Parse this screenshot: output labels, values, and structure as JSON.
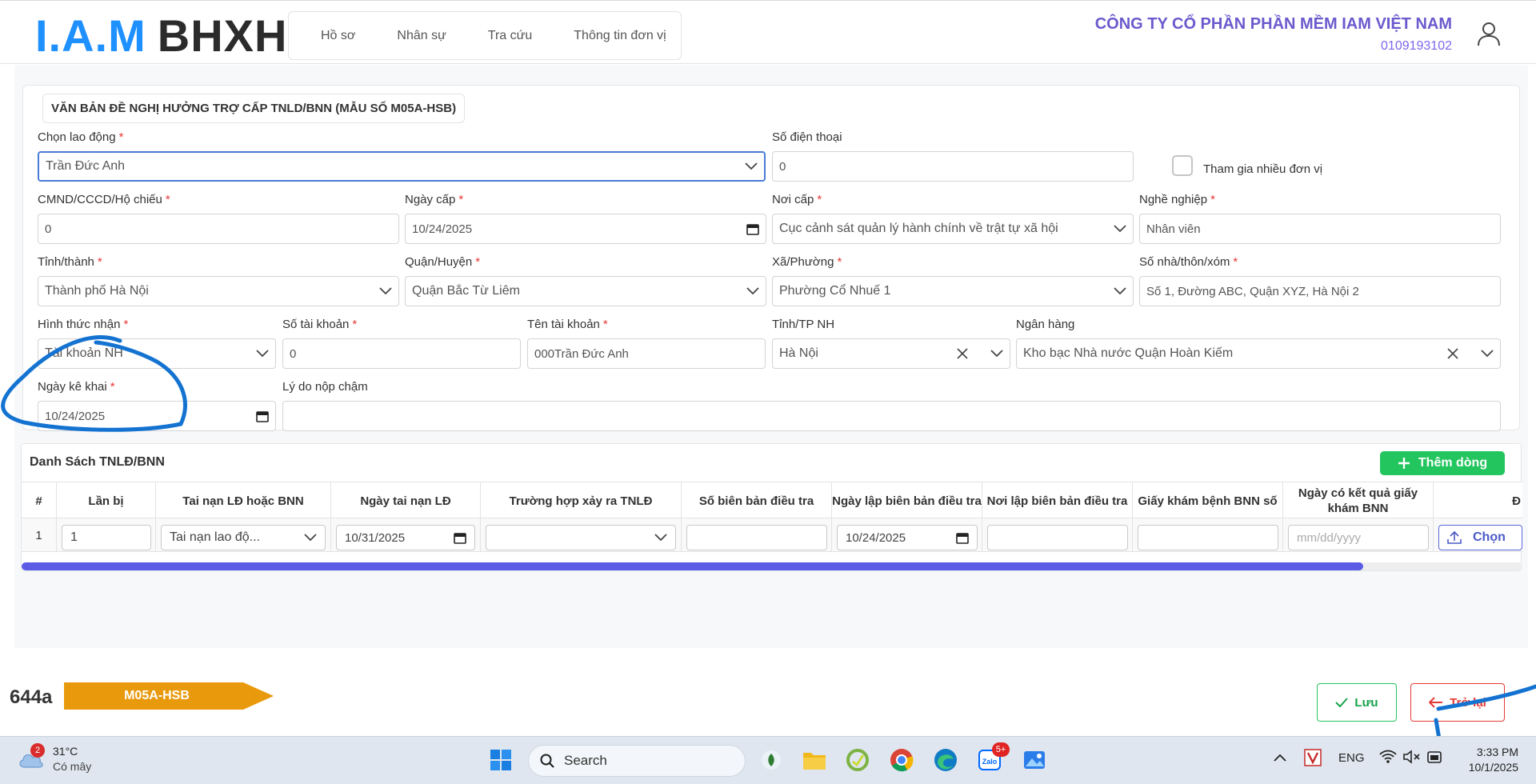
{
  "header": {
    "logo_left": "I.A.M",
    "logo_right": "BHXH",
    "nav": [
      "Hồ sơ",
      "Nhân sự",
      "Tra cứu",
      "Thông tin đơn vị"
    ],
    "company_name": "CÔNG TY CỔ PHẦN PHẦN MỀM IAM VIỆT NAM",
    "tax_code": "0109193102"
  },
  "form": {
    "title": "VĂN BẢN ĐỀ NGHỊ HƯỞNG TRỢ CẤP TNLD/BNN (MẪU SỐ M05A-HSB)",
    "required_mark": "*",
    "employee": {
      "label": "Chọn lao động",
      "value": "Trần Đức Anh"
    },
    "phone": {
      "label": "Số điện thoại",
      "value": "0"
    },
    "multi_unit": {
      "label": "Tham gia nhiều đơn vị",
      "checked": false
    },
    "id_number": {
      "label": "CMND/CCCD/Hộ chiếu",
      "value": "0"
    },
    "issue_date": {
      "label": "Ngày cấp",
      "value": "10/24/2025"
    },
    "issue_place": {
      "label": "Nơi cấp",
      "value": "Cục cảnh sát quản lý hành chính về trật tự xã hội"
    },
    "occupation": {
      "label": "Nghề nghiệp",
      "value": "Nhân viên"
    },
    "province": {
      "label": "Tỉnh/thành",
      "value": "Thành phố Hà Nội"
    },
    "district": {
      "label": "Quận/Huyện",
      "value": "Quận Bắc Từ Liêm"
    },
    "ward": {
      "label": "Xã/Phường",
      "value": "Phường Cổ Nhuế 1"
    },
    "address": {
      "label": "Số nhà/thôn/xóm",
      "value": "Số 1, Đường ABC, Quận XYZ, Hà Nội 2"
    },
    "receive_method": {
      "label": "Hình thức nhận",
      "value": "Tài khoản NH"
    },
    "account_no": {
      "label": "Số tài khoản",
      "value": "0"
    },
    "account_name": {
      "label": "Tên tài khoản",
      "value": "000Trần Đức Anh"
    },
    "bank_province": {
      "label": "Tỉnh/TP NH",
      "value": "Hà Nội"
    },
    "bank": {
      "label": "Ngân hàng",
      "value": "Kho bạc Nhà nước Quận Hoàn Kiếm"
    },
    "declare_date": {
      "label": "Ngày kê khai",
      "value": "10/24/2025"
    },
    "late_reason": {
      "label": "Lý do nộp chậm",
      "value": ""
    }
  },
  "table": {
    "title": "Danh Sách TNLĐ/BNN",
    "add_button": "Thêm dòng",
    "columns": [
      "#",
      "Lần bị",
      "Tai nạn LĐ hoặc BNN",
      "Ngày tai nạn LĐ",
      "Trường hợp xảy ra TNLĐ",
      "Số biên bản điều tra",
      "Ngày lập biên bản điều tra",
      "Nơi lập biên bản điều tra",
      "Giấy khám bệnh BNN số",
      "Ngày có kết quả giấy khám BNN",
      "Đ"
    ],
    "rows": [
      {
        "index": "1",
        "times": "1",
        "type": "Tai nạn lao độ...",
        "accident_date": "10/31/2025",
        "case": "",
        "report_no": "",
        "report_date": "10/24/2025",
        "report_place": "",
        "bnn_paper": "",
        "result_date_placeholder": "mm/dd/yyyy",
        "upload_label": "Chọn"
      }
    ],
    "scroll_fraction": 0.894
  },
  "footer": {
    "doc_code": "644a",
    "form_tag": "M05A-HSB",
    "save": "Lưu",
    "back": "Trở lại"
  },
  "taskbar": {
    "weather_temp": "31°C",
    "weather_desc": "Có mây",
    "weather_badge": "2",
    "search": "Search",
    "zalo_badge": "5+",
    "lang": "ENG",
    "time": "3:33 PM",
    "date": "10/1/2025"
  },
  "colors": {
    "logo_blue": "#1e90ff",
    "company_purple": "#6a5acd",
    "required_red": "#e53935",
    "add_green": "#22c55e",
    "tag_orange": "#e89a0c",
    "scroll_blue": "#5b5be6",
    "annotation_blue": "#1473d1"
  }
}
